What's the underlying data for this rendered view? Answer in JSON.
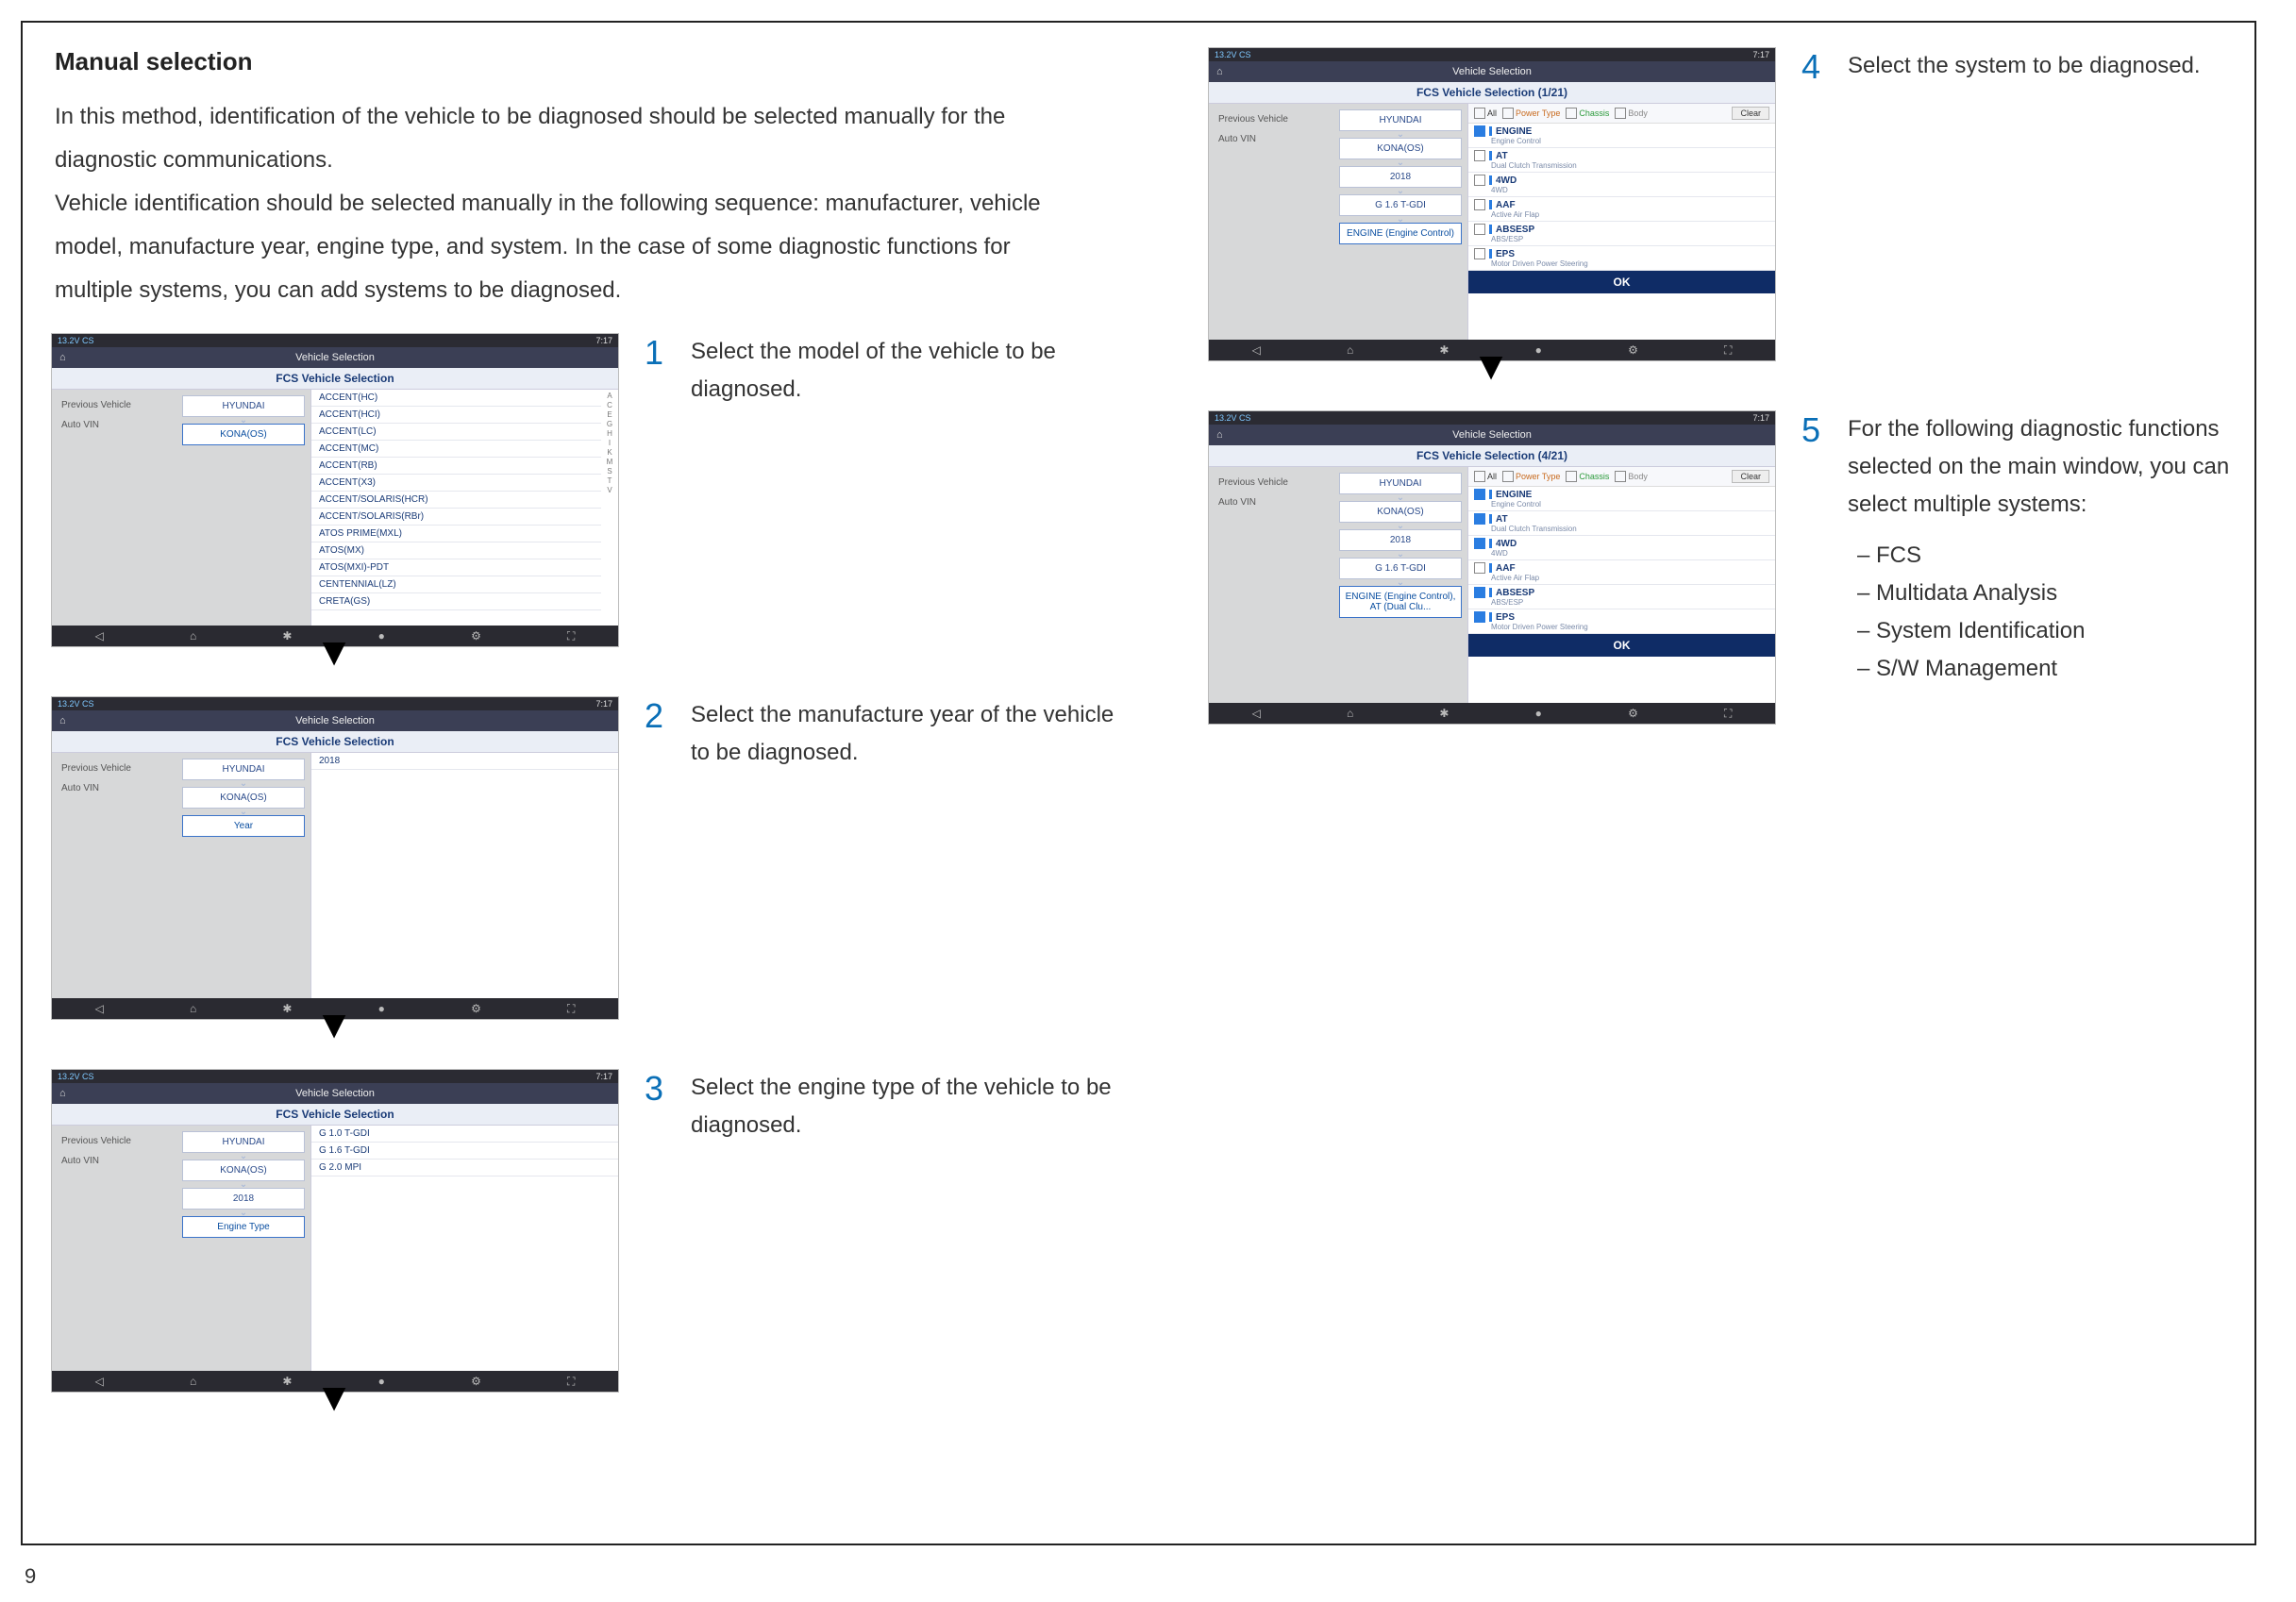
{
  "page": {
    "number": "9"
  },
  "heading": "Manual selection",
  "intro_line1": "In this method, identification of the vehicle to be diagnosed should be selected manually for the diagnostic communications.",
  "intro_line2": "Vehicle identification should be selected manually in the following sequence: manufacturer, vehicle model, manufacture year, engine type, and system. In the case of some diagnostic functions for multiple systems, you can add systems to be diagnosed.",
  "steps": {
    "1": {
      "num": "1",
      "caption": "Select the model of the vehicle to be diagnosed."
    },
    "2": {
      "num": "2",
      "caption": "Select the manufacture year of the vehicle to be diagnosed."
    },
    "3": {
      "num": "3",
      "caption": "Select the engine type of the vehicle to be diagnosed."
    },
    "4": {
      "num": "4",
      "caption": "Select the system to be diagnosed."
    },
    "5": {
      "num": "5",
      "caption": "For the following diagnostic functions selected on the main window, you can select multiple systems:",
      "bullets": [
        "FCS",
        "Multidata Analysis",
        "System Identification",
        "S/W Management"
      ]
    }
  },
  "common": {
    "status_left": "13.2V CS",
    "status_right": "7:17",
    "titlebar": "Vehicle Selection",
    "sidebar": [
      "Previous Vehicle",
      "Auto VIN"
    ],
    "nav_icons": [
      "◁",
      "⌂",
      "✱",
      "●",
      "⚙",
      "⛶"
    ],
    "crumb_sep": "⌄",
    "ok": "OK",
    "clear": "Clear",
    "filter_all": "All",
    "filter_power": "Power Type",
    "filter_chassis": "Chassis",
    "filter_body": "Body"
  },
  "shot1": {
    "subtitle": "FCS Vehicle Selection",
    "crumbs": [
      "HYUNDAI",
      "KONA(OS)"
    ],
    "active": 1,
    "models": [
      "ACCENT(HC)",
      "ACCENT(HCI)",
      "ACCENT(LC)",
      "ACCENT(MC)",
      "ACCENT(RB)",
      "ACCENT(X3)",
      "ACCENT/SOLARIS(HCR)",
      "ACCENT/SOLARIS(RBr)",
      "ATOS PRIME(MXL)",
      "ATOS(MX)",
      "ATOS(MXI)-PDT",
      "CENTENNIAL(LZ)",
      "CRETA(GS)"
    ],
    "az": [
      "A",
      "C",
      "E",
      "G",
      "H",
      "I",
      "K",
      "M",
      "S",
      "T",
      "V"
    ]
  },
  "shot2": {
    "subtitle": "FCS Vehicle Selection",
    "crumbs": [
      "HYUNDAI",
      "KONA(OS)",
      "Year"
    ],
    "active": 2,
    "years": [
      "2018"
    ]
  },
  "shot3": {
    "subtitle": "FCS Vehicle Selection",
    "crumbs": [
      "HYUNDAI",
      "KONA(OS)",
      "2018",
      "Engine Type"
    ],
    "active": 3,
    "engines": [
      "G 1.0 T-GDI",
      "G 1.6 T-GDI",
      "G 2.0 MPI"
    ]
  },
  "shot4": {
    "subtitle": "FCS Vehicle Selection (1/21)",
    "crumbs": [
      "HYUNDAI",
      "KONA(OS)",
      "2018",
      "G 1.6 T-GDI",
      "ENGINE (Engine Control)"
    ],
    "active": 4,
    "systems": [
      {
        "chk": true,
        "name": "ENGINE",
        "sub": "Engine Control"
      },
      {
        "chk": false,
        "name": "AT",
        "sub": "Dual Clutch Transmission"
      },
      {
        "chk": false,
        "name": "4WD",
        "sub": "4WD"
      },
      {
        "chk": false,
        "name": "AAF",
        "sub": "Active Air Flap"
      },
      {
        "chk": false,
        "name": "ABSESP",
        "sub": "ABS/ESP"
      },
      {
        "chk": false,
        "name": "EPS",
        "sub": "Motor Driven Power Steering"
      }
    ]
  },
  "shot5": {
    "subtitle": "FCS Vehicle Selection (4/21)",
    "crumbs": [
      "HYUNDAI",
      "KONA(OS)",
      "2018",
      "G 1.6 T-GDI",
      "ENGINE (Engine Control), AT (Dual Clu..."
    ],
    "active": 4,
    "systems": [
      {
        "chk": true,
        "name": "ENGINE",
        "sub": "Engine Control"
      },
      {
        "chk": true,
        "name": "AT",
        "sub": "Dual Clutch Transmission"
      },
      {
        "chk": true,
        "name": "4WD",
        "sub": "4WD"
      },
      {
        "chk": false,
        "name": "AAF",
        "sub": "Active Air Flap"
      },
      {
        "chk": true,
        "name": "ABSESP",
        "sub": "ABS/ESP"
      },
      {
        "chk": true,
        "name": "EPS",
        "sub": "Motor Driven Power Steering"
      }
    ]
  }
}
